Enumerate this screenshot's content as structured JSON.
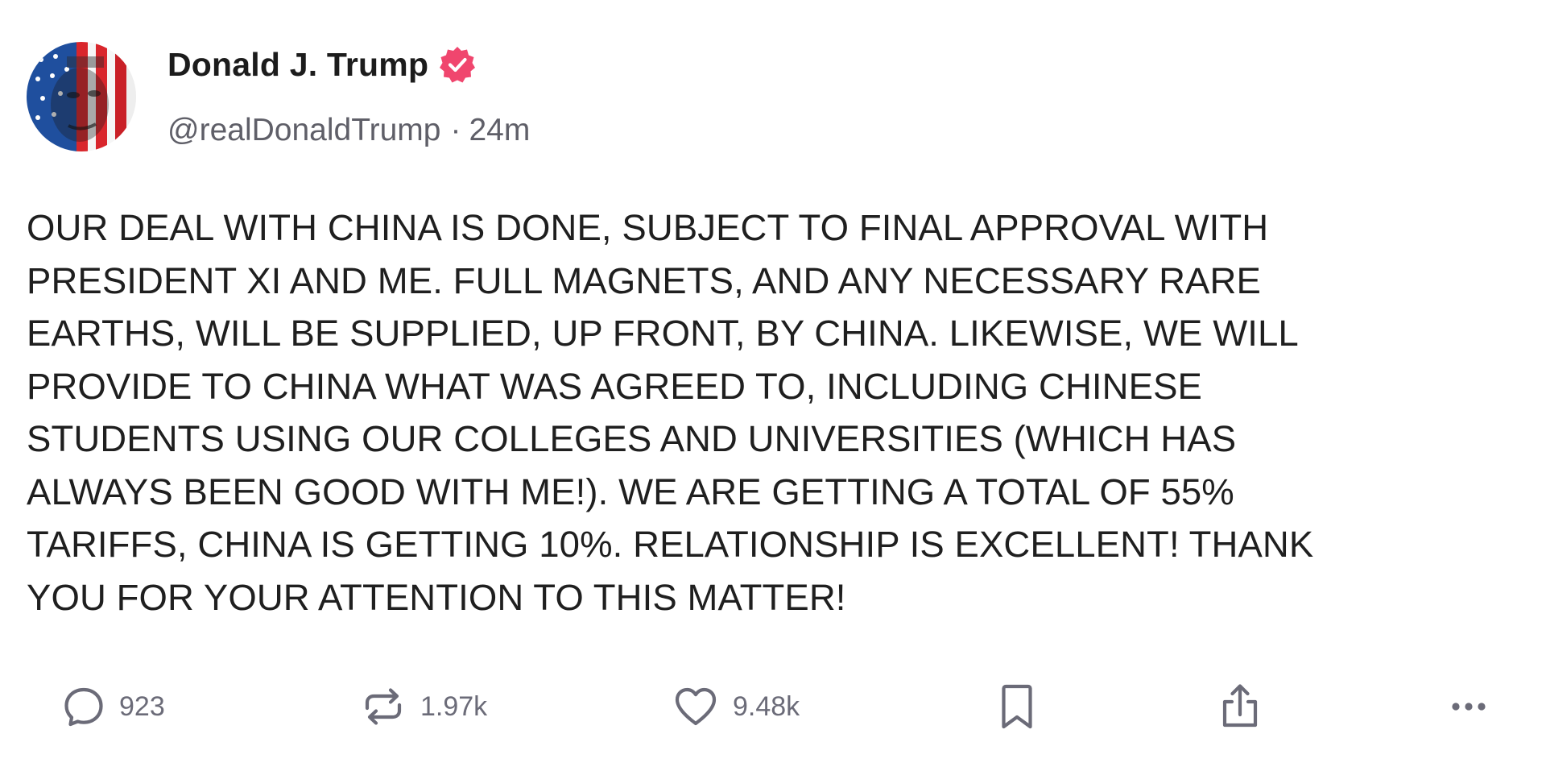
{
  "author": {
    "display_name": "Donald J. Trump",
    "handle": "@realDonaldTrump",
    "separator": "·",
    "time_ago": "24m",
    "verified": true,
    "verified_color": "#f0466e"
  },
  "post": {
    "text": "OUR DEAL WITH CHINA IS DONE, SUBJECT TO FINAL APPROVAL WITH\nPRESIDENT XI AND ME. FULL MAGNETS, AND ANY NECESSARY RARE\nEARTHS, WILL BE SUPPLIED, UP FRONT, BY CHINA. LIKEWISE, WE WILL\nPROVIDE TO CHINA WHAT WAS AGREED TO, INCLUDING CHINESE\nSTUDENTS USING OUR COLLEGES AND UNIVERSITIES (WHICH HAS\nALWAYS BEEN GOOD WITH ME!). WE ARE GETTING A TOTAL OF 55%\nTARIFFS, CHINA IS GETTING 10%. RELATIONSHIP IS EXCELLENT! THANK\nYOU FOR YOUR ATTENTION TO THIS MATTER!"
  },
  "actions": {
    "replies": "923",
    "retruths": "1.97k",
    "likes": "9.48k",
    "icons": [
      "reply-icon",
      "retruth-icon",
      "like-icon",
      "bookmark-icon",
      "share-icon",
      "more-icon"
    ],
    "icon_color": "#6b6b78"
  }
}
